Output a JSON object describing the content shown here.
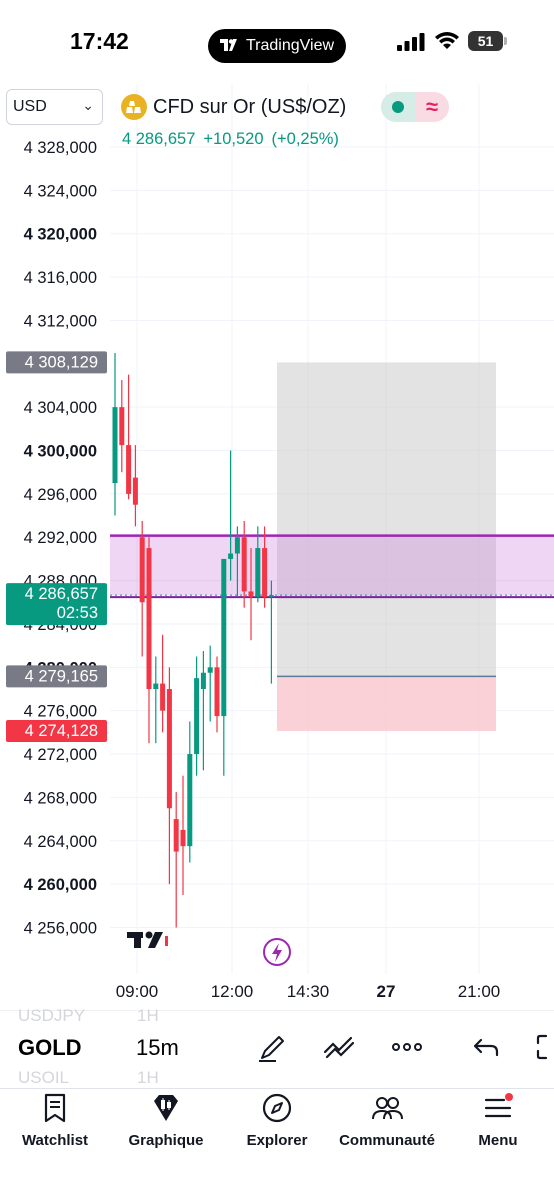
{
  "status_bar": {
    "time": "17:42",
    "island_label": "TradingView",
    "battery": "51"
  },
  "currency_selector": {
    "value": "USD"
  },
  "symbol": {
    "name": "CFD sur Or (US$/OZ)",
    "last_price": "4 286,657",
    "change": "+10,520",
    "change_pct": "(+0,25%)"
  },
  "price_axis": {
    "ticks": [
      {
        "label": "4 328,000",
        "value": 4328,
        "bold": false
      },
      {
        "label": "4 324,000",
        "value": 4324,
        "bold": false
      },
      {
        "label": "4 320,000",
        "value": 4320,
        "bold": true
      },
      {
        "label": "4 316,000",
        "value": 4316,
        "bold": false
      },
      {
        "label": "4 312,000",
        "value": 4312,
        "bold": false
      },
      {
        "label": "4 304,000",
        "value": 4304,
        "bold": false
      },
      {
        "label": "4 300,000",
        "value": 4300,
        "bold": true
      },
      {
        "label": "4 296,000",
        "value": 4296,
        "bold": false
      },
      {
        "label": "4 292,000",
        "value": 4292,
        "bold": false
      },
      {
        "label": "4 288,000",
        "value": 4288,
        "bold": false
      },
      {
        "label": "4 284,000",
        "value": 4284,
        "bold": false
      },
      {
        "label": "4 280,000",
        "value": 4280,
        "bold": true
      },
      {
        "label": "4 276,000",
        "value": 4276,
        "bold": false
      },
      {
        "label": "4 272,000",
        "value": 4272,
        "bold": false
      },
      {
        "label": "4 268,000",
        "value": 4268,
        "bold": false
      },
      {
        "label": "4 264,000",
        "value": 4264,
        "bold": false
      },
      {
        "label": "4 260,000",
        "value": 4260,
        "bold": true
      },
      {
        "label": "4 256,000",
        "value": 4256,
        "bold": false
      }
    ],
    "tags": [
      {
        "label": "4 308,129",
        "value": 4308.129,
        "color": "#787b86",
        "sub": ""
      },
      {
        "label": "4 286,657",
        "value": 4286.657,
        "color": "#089981",
        "sub": "02:53"
      },
      {
        "label": "4 279,165",
        "value": 4279.165,
        "color": "#787b86",
        "sub": ""
      },
      {
        "label": "4 274,128",
        "value": 4274.128,
        "color": "#f23645",
        "sub": ""
      }
    ]
  },
  "time_axis": {
    "ticks": [
      {
        "label": "09:00",
        "bold": false
      },
      {
        "label": "12:00",
        "bold": false
      },
      {
        "label": "14:30",
        "bold": false
      },
      {
        "label": "27",
        "bold": true
      },
      {
        "label": "21:00",
        "bold": false
      }
    ]
  },
  "chart_data": {
    "type": "candlestick",
    "interval": "15m",
    "up_color": "#089981",
    "down_color": "#f23645",
    "candles": [
      {
        "o": 4297.0,
        "h": 4309.0,
        "l": 4294.0,
        "c": 4304.0
      },
      {
        "o": 4304.0,
        "h": 4306.5,
        "l": 4298.0,
        "c": 4300.5
      },
      {
        "o": 4300.5,
        "h": 4307.0,
        "l": 4295.5,
        "c": 4296.0
      },
      {
        "o": 4297.5,
        "h": 4300.5,
        "l": 4293.0,
        "c": 4295.0
      },
      {
        "o": 4292.0,
        "h": 4293.5,
        "l": 4281.0,
        "c": 4286.0
      },
      {
        "o": 4291.0,
        "h": 4292.0,
        "l": 4273.0,
        "c": 4278.0
      },
      {
        "o": 4278.0,
        "h": 4281.0,
        "l": 4273.0,
        "c": 4278.5
      },
      {
        "o": 4278.5,
        "h": 4283.0,
        "l": 4274.0,
        "c": 4276.0
      },
      {
        "o": 4278.0,
        "h": 4280.0,
        "l": 4260.0,
        "c": 4267.0
      },
      {
        "o": 4266.0,
        "h": 4268.5,
        "l": 4256.0,
        "c": 4263.0
      },
      {
        "o": 4265.0,
        "h": 4270.0,
        "l": 4259.0,
        "c": 4263.5
      },
      {
        "o": 4263.5,
        "h": 4275.0,
        "l": 4262.0,
        "c": 4272.0
      },
      {
        "o": 4272.0,
        "h": 4281.0,
        "l": 4270.0,
        "c": 4279.0
      },
      {
        "o": 4278.0,
        "h": 4281.5,
        "l": 4270.5,
        "c": 4279.5
      },
      {
        "o": 4279.5,
        "h": 4282.0,
        "l": 4275.0,
        "c": 4280.0
      },
      {
        "o": 4280.0,
        "h": 4281.0,
        "l": 4274.0,
        "c": 4275.5
      },
      {
        "o": 4275.5,
        "h": 4286.0,
        "l": 4270.0,
        "c": 4290.0
      },
      {
        "o": 4290.0,
        "h": 4300.0,
        "l": 4288.0,
        "c": 4290.5
      },
      {
        "o": 4290.5,
        "h": 4293.0,
        "l": 4286.5,
        "c": 4292.0
      },
      {
        "o": 4292.0,
        "h": 4293.5,
        "l": 4285.5,
        "c": 4287.0
      },
      {
        "o": 4287.0,
        "h": 4291.0,
        "l": 4282.5,
        "c": 4286.5
      },
      {
        "o": 4286.5,
        "h": 4293.0,
        "l": 4286.0,
        "c": 4291.0
      },
      {
        "o": 4291.0,
        "h": 4293.0,
        "l": 4285.5,
        "c": 4286.5
      },
      {
        "o": 4286.5,
        "h": 4288.0,
        "l": 4278.5,
        "c": 4286.657
      }
    ],
    "purple_zone": {
      "top": 4292.15,
      "bottom": 4286.657
    },
    "position_box": {
      "profit_top": 4308.129,
      "entry": 4279.165,
      "stop": 4274.128
    }
  },
  "toolbar": {
    "symbol": "GOLD",
    "interval": "15m",
    "ghost_prev_symbol": "USDJPY",
    "ghost_prev_interval": "1H",
    "ghost_next_symbol": "USOIL",
    "ghost_next_interval": "1H"
  },
  "nav": {
    "items": [
      {
        "label": "Watchlist",
        "icon": "watchlist-icon"
      },
      {
        "label": "Graphique",
        "icon": "chart-icon"
      },
      {
        "label": "Explorer",
        "icon": "compass-icon"
      },
      {
        "label": "Communauté",
        "icon": "community-icon"
      },
      {
        "label": "Menu",
        "icon": "menu-icon"
      }
    ]
  }
}
